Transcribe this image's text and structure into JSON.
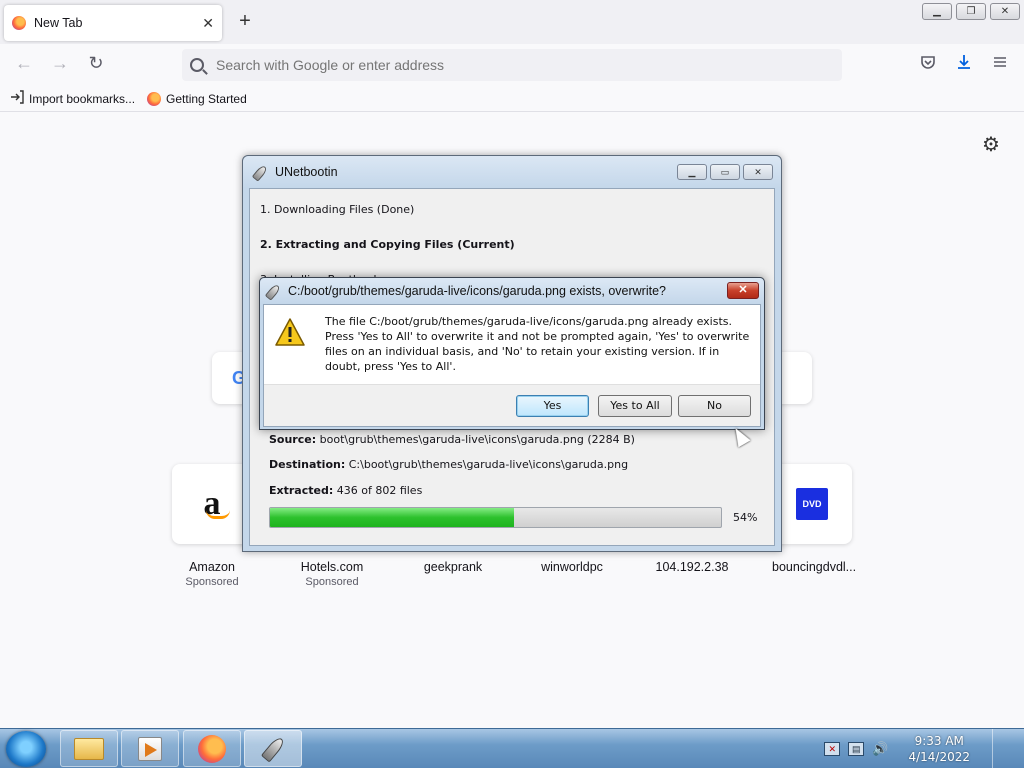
{
  "browser": {
    "tab_title": "New Tab",
    "tab_close": "✕",
    "new_tab": "+",
    "url_placeholder": "Search with Google or enter address",
    "nav": {
      "back": "←",
      "forward": "→",
      "reload": "↻"
    },
    "bookmarks": [
      {
        "label": "Import bookmarks..."
      },
      {
        "label": "Getting Started"
      }
    ],
    "window_controls": {
      "minimize": "▁",
      "maximize": "❐",
      "close": "✕"
    }
  },
  "newtab": {
    "google_glyph": "G",
    "sites": [
      {
        "name": "Amazon",
        "sponsor": "Sponsored",
        "logo": "a"
      },
      {
        "name": "Hotels.com",
        "sponsor": "Sponsored"
      },
      {
        "name": "geekprank"
      },
      {
        "name": "winworldpc"
      },
      {
        "name": "104.192.2.38"
      },
      {
        "name": "bouncingdvdl...",
        "logo": "DVD"
      }
    ]
  },
  "unetbootin": {
    "title": "UNetbootin",
    "steps": {
      "step1": "1. Downloading Files (Done)",
      "step2": "2. Extracting and Copying Files (Current)",
      "step3_partial": "3. Installing Bootloader"
    },
    "source_label": "Source:",
    "source_value": "boot\\grub\\themes\\garuda-live\\icons\\garuda.png (2284 B)",
    "destination_label": "Destination:",
    "destination_value": "C:\\boot\\grub\\themes\\garuda-live\\icons\\garuda.png",
    "extracted_label": "Extracted:",
    "extracted_value": "436 of 802 files",
    "progress_percent": 54,
    "progress_text": "54%",
    "controls": {
      "minimize": "▁",
      "maximize": "▭",
      "close": "✕"
    }
  },
  "dialog": {
    "title": "C:/boot/grub/themes/garuda-live/icons/garuda.png exists, overwrite?",
    "close": "✕",
    "message": "The file C:/boot/grub/themes/garuda-live/icons/garuda.png already exists. Press 'Yes to All' to overwrite it and not be prompted again, 'Yes' to overwrite files on an individual basis, and 'No' to retain your existing version. If in doubt, press 'Yes to All'.",
    "buttons": {
      "yes": "Yes",
      "yes_all": "Yes to All",
      "no": "No"
    }
  },
  "taskbar": {
    "time": "9:33 AM",
    "date": "4/14/2022",
    "tray": {
      "flag": "✕",
      "network": "▤",
      "volume": "🔊"
    }
  }
}
